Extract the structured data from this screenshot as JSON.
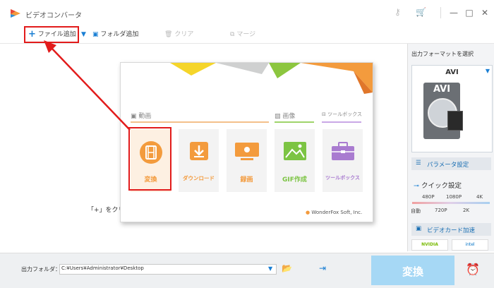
{
  "window": {
    "title": "ビデオコンバータ"
  },
  "toolbar": {
    "add_file_label": "ファイル追加",
    "add_folder_label": "フォルダ追加",
    "clear_label": "クリア",
    "merge_label": "マージ"
  },
  "main": {
    "hint_text": "「+」をクリッ"
  },
  "popup": {
    "sections": {
      "video": "動画",
      "image": "画像",
      "toolbox": "ツールボックス"
    },
    "tiles": [
      {
        "label": "変換",
        "icon": "film-icon",
        "color": "#f39b3d"
      },
      {
        "label": "ダウンロード",
        "icon": "download-icon",
        "color": "#f39b3d"
      },
      {
        "label": "録画",
        "icon": "screen-record-icon",
        "color": "#f39b3d"
      },
      {
        "label": "GIF作成",
        "icon": "image-icon",
        "color": "#7cc443"
      },
      {
        "label": "ツールボックス",
        "icon": "toolbox-icon",
        "color": "#a97bd0"
      }
    ],
    "brand": "WonderFox Soft, Inc."
  },
  "right_panel": {
    "title": "出力フォーマットを選択",
    "format": "AVI",
    "format_image_text": "AVI",
    "params_label": "パラメータ設定",
    "quick_settings": {
      "title": "クイック設定",
      "top_labels": [
        "480P",
        "1080P",
        "4K"
      ],
      "bottom_labels": [
        "自動",
        "720P",
        "2K"
      ]
    },
    "gpu_label": "ビデオカード加速",
    "nvidia": "NVIDIA",
    "intel": "intel"
  },
  "bottom": {
    "output_label": "出力フォルダ：",
    "output_path": "C:¥Users¥Administrator¥Desktop",
    "convert_label": "変換"
  },
  "colors": {
    "accent_blue": "#1a7fd4",
    "highlight_red": "#e21b1b",
    "orange": "#f39b3d",
    "green": "#7cc443",
    "purple": "#a97bd0",
    "convert_button": "#a6d8f5"
  }
}
